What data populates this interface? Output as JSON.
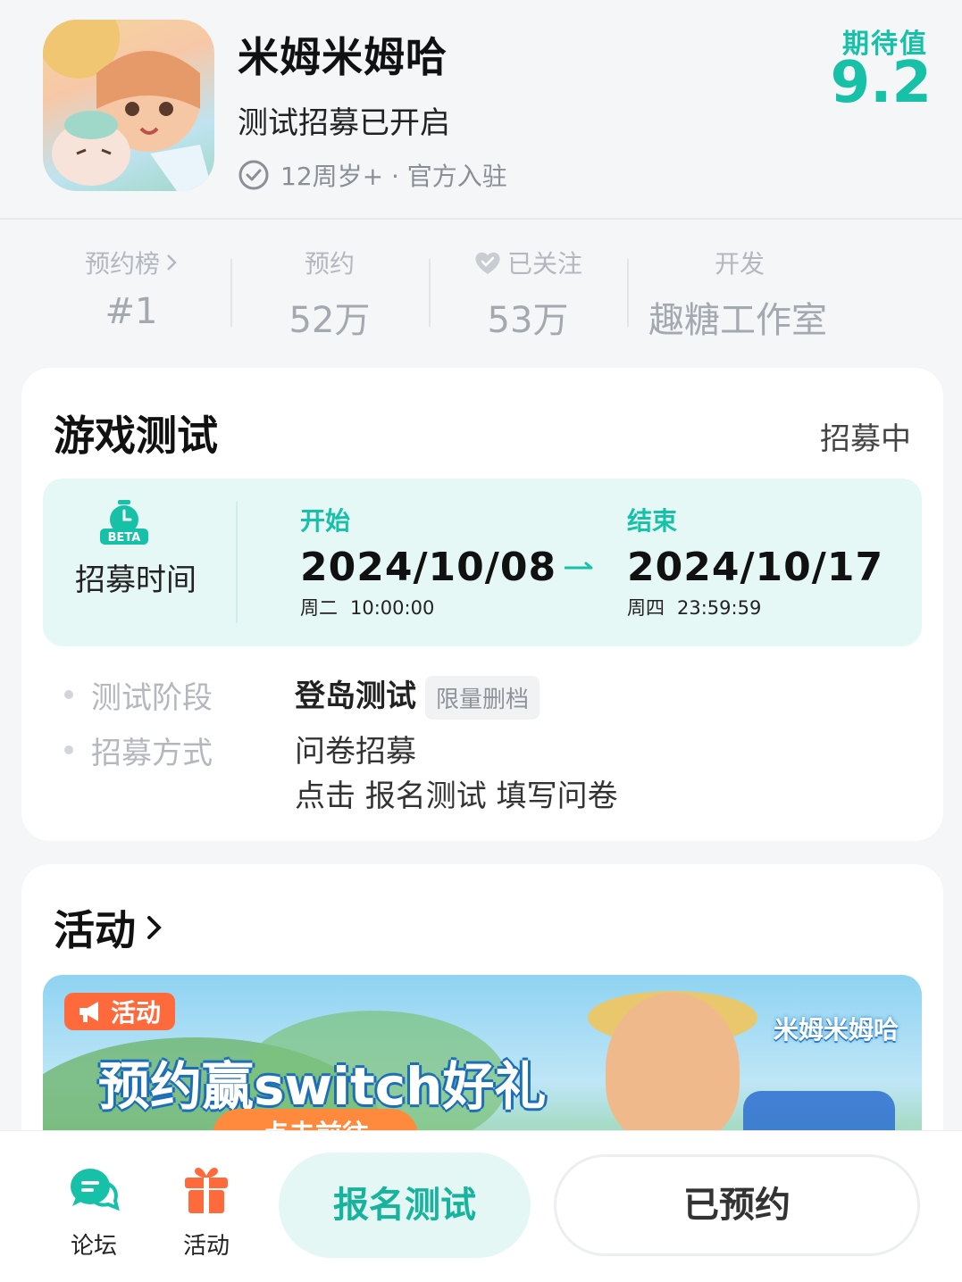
{
  "header": {
    "title": "米姆米姆哈",
    "subtitle": "测试招募已开启",
    "meta": "12周岁+ · 官方入驻",
    "expect_label": "期待值",
    "expect_value": "9.2"
  },
  "stats": [
    {
      "label": "预约榜",
      "value": "#1"
    },
    {
      "label": "预约",
      "value": "52万"
    },
    {
      "label": "已关注",
      "value": "53万"
    },
    {
      "label": "开发",
      "value": "趣糖工作室"
    }
  ],
  "test_section": {
    "title": "游戏测试",
    "status": "招募中",
    "recruit_label": "招募时间",
    "beta_text": "BETA",
    "start": {
      "label": "开始",
      "date": "2024/10/08",
      "weekday": "周二",
      "time": "10:00:00"
    },
    "end": {
      "label": "结束",
      "date": "2024/10/17",
      "weekday": "周四",
      "time": "23:59:59"
    },
    "phase_key": "测试阶段",
    "phase_value": "登岛测试",
    "phase_tag": "限量删档",
    "method_key": "招募方式",
    "method_value": "问卷招募",
    "method_hint": "点击 报名测试 填写问卷"
  },
  "activity_section": {
    "title": "活动",
    "banner_tag": "活动",
    "banner_text": "预约赢switch好礼",
    "banner_logo": "米姆米姆哈",
    "banner_button": "点击前往"
  },
  "bottom_bar": {
    "forum_label": "论坛",
    "activity_label": "活动",
    "signup_button": "报名测试",
    "reserved_button": "已预约"
  },
  "colors": {
    "accent": "#17c1a8",
    "activity_orange": "#ff6a3d",
    "recruit_bg": "#e6f8f6"
  }
}
